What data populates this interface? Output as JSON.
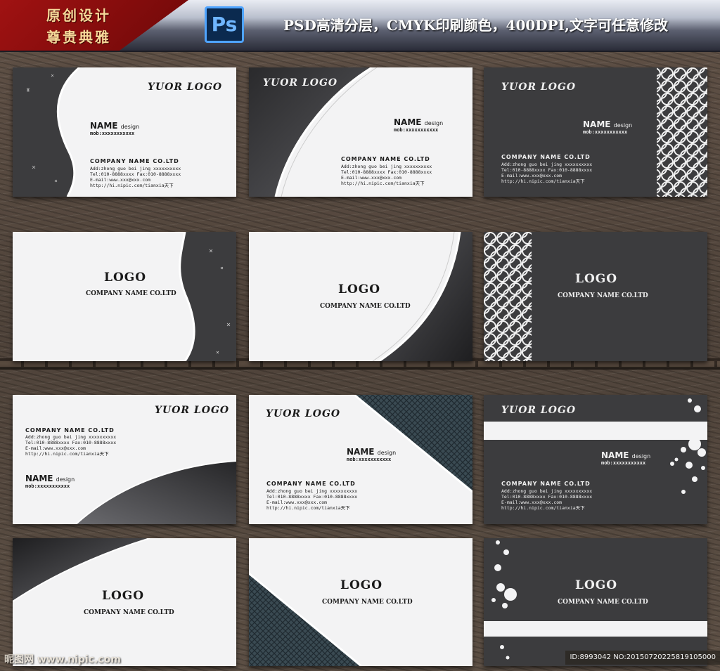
{
  "banner": {
    "badge_line1": "原创设计",
    "badge_line2": "尊贵典雅",
    "ps_icon": "Ps",
    "text": "PSD高清分层，CMYK印刷颜色，400DPI,文字可任意修改"
  },
  "contact": {
    "logo": "YUOR LOGO",
    "name": "NAME",
    "design": "design",
    "mob": "mob:xxxxxxxxxxx",
    "company": "COMPANY NAME CO.LTD",
    "add": "Add:zhong guo bei jing xxxxxxxxxx",
    "tel": "Tel:010-8888xxxx Fax:010-8888xxxx",
    "email": "E-mail:www.xxx@xxx.com",
    "http": "http://hi.nipic.com/tianxia天下"
  },
  "back": {
    "logo": "LOGO",
    "company": "COMPANY NAME CO.LTD"
  },
  "watermark": {
    "left": "昵图网 www.nipic.com",
    "right": "ID:8993042 NO:20150720225819105000"
  },
  "colors": {
    "card_dark": "#3c3c3e",
    "card_light": "#f3f3f4",
    "banner_red": "#a01212",
    "ps_blue": "#4fa4ff"
  }
}
